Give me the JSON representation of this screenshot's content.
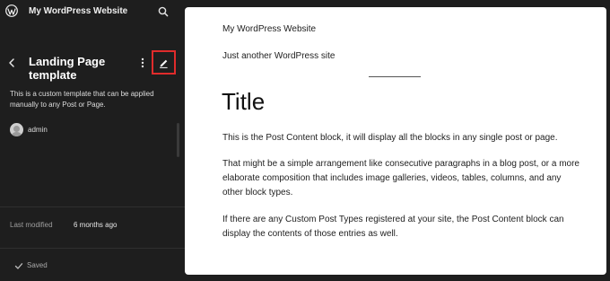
{
  "header": {
    "site_name": "My WordPress Website",
    "logo_icon": "wordpress-logo-icon",
    "search_icon": "search-icon"
  },
  "template": {
    "title": "Landing Page template",
    "description": "This is a custom template that can be applied manually to any Post or Page.",
    "author": "admin",
    "actions": {
      "back_icon": "chevron-left-icon",
      "more_icon": "more-vertical-icon",
      "edit_icon": "pencil-icon"
    }
  },
  "meta": {
    "last_modified_label": "Last modified",
    "last_modified_value": "6 months ago"
  },
  "status": {
    "saved_label": "Saved",
    "saved_icon": "check-icon"
  },
  "preview": {
    "site_title": "My WordPress Website",
    "tagline": "Just another WordPress site",
    "post_title": "Title",
    "paragraphs": [
      "This is the Post Content block, it will display all the blocks in any single post or page.",
      "That might be a simple arrangement like consecutive paragraphs in a blog post, or a more elaborate composition that includes image galleries, videos, tables, columns, and any other block types.",
      "If there are any Custom Post Types registered at your site, the Post Content block can display the contents of those entries as well."
    ]
  },
  "colors": {
    "sidebar_bg": "#1e1e1e",
    "canvas_bg": "#ffffff",
    "highlight_border": "#e02b2b"
  }
}
